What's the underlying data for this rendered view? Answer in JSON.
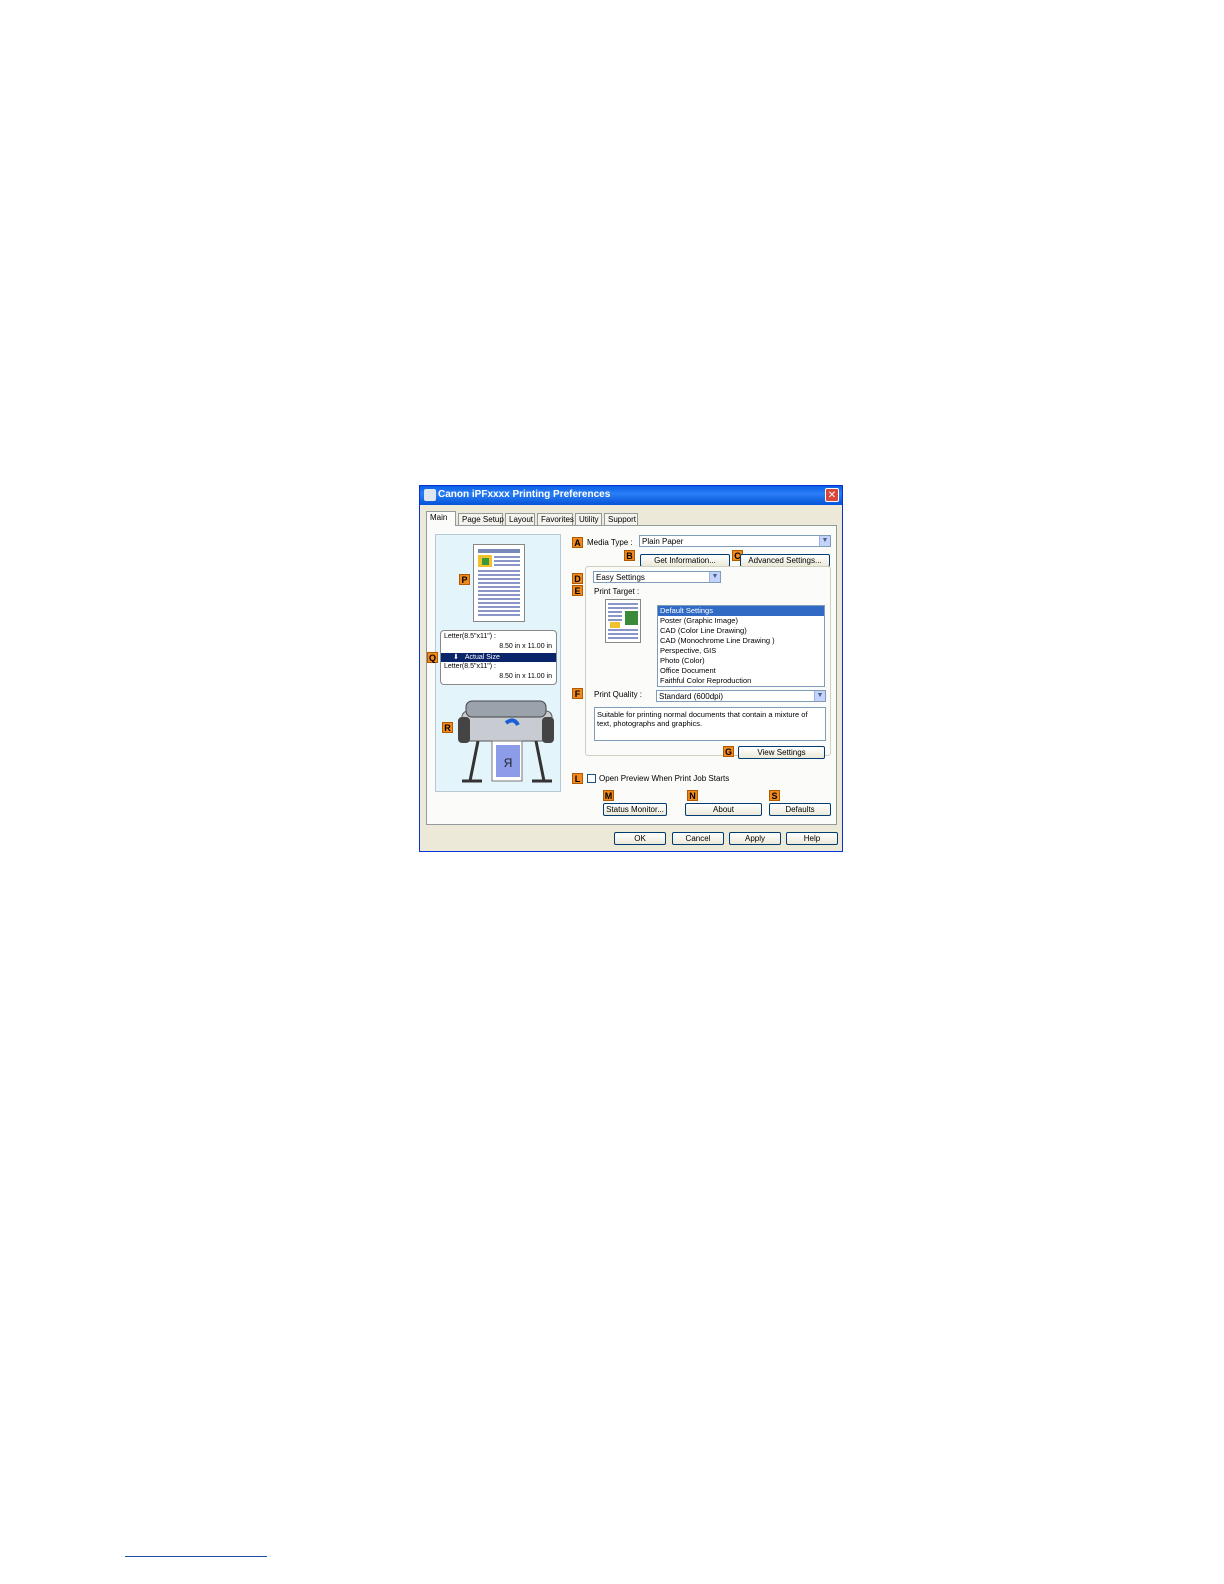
{
  "window": {
    "title": "Canon iPFxxxx Printing Preferences",
    "close": "✕"
  },
  "tabs": [
    "Main",
    "Page Setup",
    "Layout",
    "Favorites",
    "Utility",
    "Support"
  ],
  "preview": {
    "marker_p": "P",
    "marker_q": "Q",
    "marker_r": "R",
    "size_original": "Letter(8.5\"x11\") :",
    "size_original_dims": "8.50 in x 11.00 in",
    "scaling": "Actual Size",
    "size_output": "Letter(8.5\"x11\") :",
    "size_output_dims": "8.50 in x 11.00 in",
    "printer_sheet_letter": "R"
  },
  "media_type": {
    "marker": "A",
    "label": "Media Type :",
    "value": "Plain Paper"
  },
  "get_info": {
    "marker": "B",
    "label": "Get Information..."
  },
  "advanced": {
    "marker": "C",
    "label": "Advanced Settings..."
  },
  "mode": {
    "marker": "D",
    "value": "Easy Settings"
  },
  "print_target": {
    "marker": "E",
    "label": "Print Target :",
    "items": [
      "Default Settings",
      "Poster (Graphic Image)",
      "CAD (Color Line Drawing)",
      "CAD (Monochrome Line Drawing )",
      "Perspective, GIS",
      "Photo (Color)",
      "Office Document",
      "Faithful Color Reproduction"
    ],
    "selected_index": 0
  },
  "print_quality": {
    "marker": "F",
    "label": "Print Quality :",
    "value": "Standard (600dpi)",
    "description": "Suitable for printing normal documents that contain a mixture of text, photographs and graphics."
  },
  "view_settings": {
    "marker": "G",
    "label": "View Settings"
  },
  "preview_checkbox": {
    "marker": "L",
    "label": "Open Preview When Print Job Starts",
    "checked": false
  },
  "status_monitor": {
    "marker": "M",
    "label": "Status Monitor..."
  },
  "about": {
    "marker": "N",
    "label": "About"
  },
  "defaults": {
    "marker": "S",
    "label": "Defaults"
  },
  "footer": {
    "ok": "OK",
    "cancel": "Cancel",
    "apply": "Apply",
    "help": "Help"
  },
  "colors": {
    "titlebar": "#0a5fe6",
    "marker": "#f08a1e",
    "selection": "#316ac5",
    "preview_bg": "#e4f4fb"
  }
}
